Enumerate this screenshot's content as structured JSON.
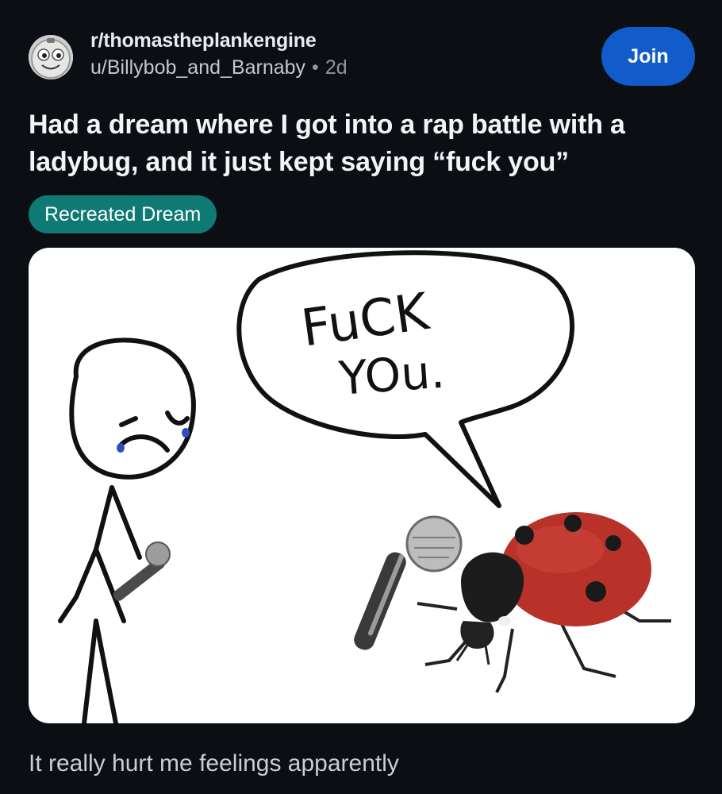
{
  "post": {
    "subreddit": "r/thomastheplankengine",
    "username": "u/Billybob_and_Barnaby",
    "separator": "•",
    "age": "2d",
    "join_label": "Join",
    "title": "Had a dream where I got into a rap battle with a ladybug, and it just kept saying “fuck you”",
    "flair": "Recreated Dream",
    "body": "It really hurt me feelings apparently"
  },
  "image": {
    "speech_line_1": "FuCK",
    "speech_line_2": "YOu."
  },
  "colors": {
    "background": "#0b0f14",
    "join_button": "#115bca",
    "flair": "#0e7a73",
    "ladybug_shell": "#b8322a"
  },
  "icons": {
    "avatar": "subreddit-avatar-face-icon",
    "microphone": "microphone-icon"
  }
}
